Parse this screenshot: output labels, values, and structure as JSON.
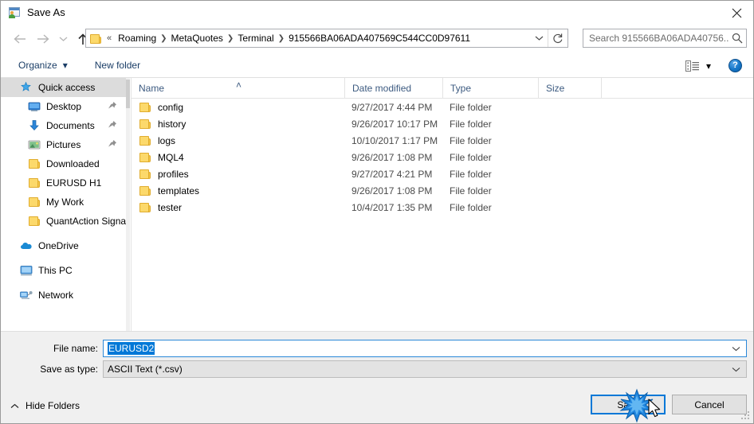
{
  "window": {
    "title": "Save As",
    "icon": "save-as-app-icon",
    "close_label": "✕"
  },
  "nav": {
    "back_icon": "arrow-left-icon",
    "forward_icon": "arrow-right-icon",
    "recent_icon": "chevron-down-icon",
    "up_icon": "arrow-up-icon"
  },
  "address": {
    "folder_icon": "folder-icon",
    "lead": "«",
    "crumbs": [
      "Roaming",
      "MetaQuotes",
      "Terminal",
      "915566BA06ADA407569C544CC0D97611"
    ],
    "separator": "❯",
    "dropdown_icon": "chevron-down-icon",
    "refresh_icon": "refresh-icon"
  },
  "search": {
    "placeholder": "Search 915566BA06ADA40756...",
    "icon": "search-icon"
  },
  "toolbar": {
    "organize_label": "Organize",
    "organize_caret": "▾",
    "new_folder_label": "New folder",
    "view_icon": "list-view-icon",
    "view_caret": "▾",
    "help_label": "?"
  },
  "sidebar": {
    "items": [
      {
        "label": "Quick access",
        "icon": "star-pin-icon",
        "selected": true,
        "indent": 0,
        "pinned": false
      },
      {
        "label": "Desktop",
        "icon": "desktop-icon",
        "selected": false,
        "indent": 1,
        "pinned": true
      },
      {
        "label": "Documents",
        "icon": "documents-download-icon",
        "selected": false,
        "indent": 1,
        "pinned": true
      },
      {
        "label": "Pictures",
        "icon": "pictures-icon",
        "selected": false,
        "indent": 1,
        "pinned": true
      },
      {
        "label": "Downloaded",
        "icon": "folder-icon",
        "selected": false,
        "indent": 1,
        "pinned": false
      },
      {
        "label": "EURUSD H1",
        "icon": "folder-icon",
        "selected": false,
        "indent": 1,
        "pinned": false
      },
      {
        "label": "My Work",
        "icon": "folder-icon",
        "selected": false,
        "indent": 1,
        "pinned": false
      },
      {
        "label": "QuantAction Signal",
        "icon": "folder-icon",
        "selected": false,
        "indent": 1,
        "pinned": false
      },
      {
        "label": "OneDrive",
        "icon": "onedrive-cloud-icon",
        "selected": false,
        "indent": 0,
        "pinned": false
      },
      {
        "label": "This PC",
        "icon": "this-pc-icon",
        "selected": false,
        "indent": 0,
        "pinned": false
      },
      {
        "label": "Network",
        "icon": "network-icon",
        "selected": false,
        "indent": 0,
        "pinned": false
      }
    ]
  },
  "filelist": {
    "columns": [
      "Name",
      "Date modified",
      "Type",
      "Size"
    ],
    "sort_column": "Name",
    "sort_caret": "˄",
    "rows": [
      {
        "name": "config",
        "date": "9/27/2017 4:44 PM",
        "type": "File folder",
        "size": ""
      },
      {
        "name": "history",
        "date": "9/26/2017 10:17 PM",
        "type": "File folder",
        "size": ""
      },
      {
        "name": "logs",
        "date": "10/10/2017 1:17 PM",
        "type": "File folder",
        "size": ""
      },
      {
        "name": "MQL4",
        "date": "9/26/2017 1:08 PM",
        "type": "File folder",
        "size": ""
      },
      {
        "name": "profiles",
        "date": "9/27/2017 4:21 PM",
        "type": "File folder",
        "size": ""
      },
      {
        "name": "templates",
        "date": "9/26/2017 1:08 PM",
        "type": "File folder",
        "size": ""
      },
      {
        "name": "tester",
        "date": "10/4/2017 1:35 PM",
        "type": "File folder",
        "size": ""
      }
    ]
  },
  "form": {
    "filename_label": "File name:",
    "filename_value": "EURUSD2",
    "filetype_label": "Save as type:",
    "filetype_value": "ASCII Text (*.csv)",
    "dropdown_icon": "chevron-down-icon"
  },
  "footer": {
    "hide_folders_label": "Hide Folders",
    "hide_folders_caret": "˄",
    "save_label": "Save",
    "cancel_label": "Cancel",
    "resize_grip_icon": "resize-grip-icon",
    "click_effect_icon": "click-burst-icon",
    "cursor_icon": "mouse-pointer-icon"
  },
  "colors": {
    "accent": "#0078d7",
    "toolbar_text": "#1a3d66",
    "folder_yellow": "#fcd96b",
    "selection_gray": "#dcdcdc",
    "panel_bg": "#f0f0f0"
  }
}
